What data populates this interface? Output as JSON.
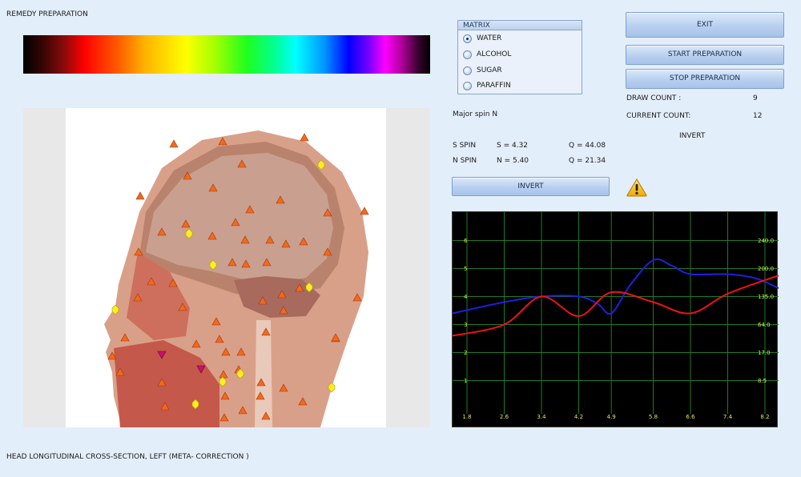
{
  "window": {
    "title": "REMEDY PREPARATION"
  },
  "image_caption": "HEAD LONGITUDINAL CROSS-SECTION, LEFT (META- CORRECTION )",
  "matrix": {
    "title": "MATRIX",
    "options": [
      {
        "label": "WATER",
        "selected": true
      },
      {
        "label": "ALCOHOL",
        "selected": false
      },
      {
        "label": "SUGAR",
        "selected": false
      },
      {
        "label": "PARAFFIN",
        "selected": false
      }
    ]
  },
  "buttons": {
    "exit": "EXIT",
    "start": "START PREPARATION",
    "stop": "STOP PREPARATION",
    "invert": "INVERT"
  },
  "counts": {
    "draw_label": "DRAW COUNT :",
    "draw_value": "9",
    "current_label": "CURRENT COUNT:",
    "current_value": "12",
    "invert_label": "INVERT"
  },
  "spin": {
    "major": "Major spin N",
    "s_label": "S SPIN",
    "s_value": "S = 4.32",
    "s_q": "Q = 44.08",
    "n_label": "N SPIN",
    "n_value": "N = 5.40",
    "n_q": "Q = 21.34"
  },
  "colors": {
    "blue_series": "#1f1fe0",
    "red_series": "#ee1414",
    "grid": "#1f7a1f",
    "tick_text": "#e6e64a",
    "marker_orange": "#f06a1c",
    "marker_yellow": "#ffee22",
    "marker_magenta": "#c8106e"
  },
  "chart_data": {
    "type": "line",
    "x": [
      1.8,
      2.6,
      3.4,
      4.2,
      4.9,
      5.8,
      6.6,
      7.4,
      8.2
    ],
    "xlabels": [
      "1.8",
      "2.6",
      "3.4",
      "4.2",
      "4.9",
      "5.8",
      "6.6",
      "7.4",
      "8.2"
    ],
    "yleft_labels": [
      "6",
      "5",
      "4",
      "3",
      "2",
      "1"
    ],
    "yright_labels": [
      "240.0",
      "200.0",
      "135.0",
      "64.0",
      "17.0",
      "8.5"
    ],
    "ylim": [
      0.5,
      6.5
    ],
    "grid": true,
    "series": [
      {
        "color": "#1f1fe0",
        "x": [
          1.8,
          2.6,
          3.4,
          4.2,
          4.6,
          4.9,
          5.3,
          5.8,
          6.2,
          6.6,
          7.4,
          8.0,
          8.2
        ],
        "y": [
          3.4,
          3.8,
          4.0,
          4.0,
          3.75,
          3.4,
          4.4,
          5.3,
          5.1,
          4.8,
          4.8,
          4.65,
          4.3
        ]
      },
      {
        "color": "#ee1414",
        "x": [
          1.8,
          2.6,
          3.4,
          4.2,
          4.9,
          5.8,
          6.6,
          7.4,
          8.2
        ],
        "y": [
          2.6,
          3.0,
          4.0,
          3.3,
          4.15,
          3.8,
          3.4,
          4.1,
          4.75
        ]
      }
    ]
  }
}
